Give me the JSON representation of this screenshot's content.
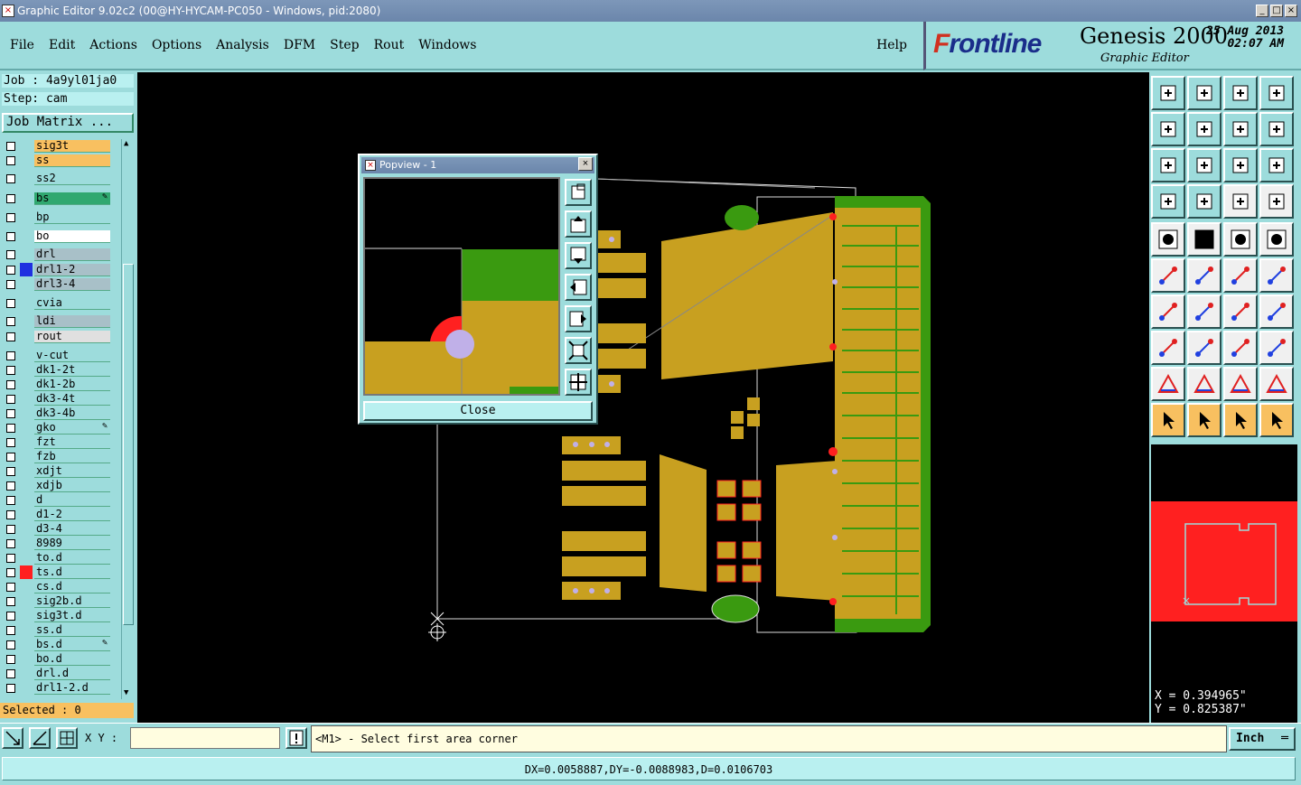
{
  "window": {
    "title": "Graphic Editor 9.02c2 (00@HY-HYCAM-PC050 - Windows, pid:2080)"
  },
  "menu": {
    "items": [
      "File",
      "Edit",
      "Actions",
      "Options",
      "Analysis",
      "DFM",
      "Step",
      "Rout",
      "Windows"
    ],
    "help": "Help"
  },
  "brand": {
    "logo_prefix": "F",
    "logo_rest": "rontline",
    "product": "Genesis 2000",
    "subtitle": "Graphic Editor",
    "date": "25 Aug 2013",
    "time": "02:07 AM"
  },
  "job": {
    "job_line": "Job : 4a9yl01ja0",
    "step_line": "Step: cam",
    "matrix_button": "Job Matrix ..."
  },
  "layers": [
    {
      "name": "sig3t",
      "color": "#f8c060",
      "swatch": ""
    },
    {
      "name": "ss",
      "color": "#f8c060",
      "swatch": ""
    },
    {
      "name": "ss2",
      "color": "#9ddcdc",
      "swatch": ""
    },
    {
      "name": "bs",
      "color": "#30a870",
      "swatch": "",
      "edit": true
    },
    {
      "name": "bp",
      "color": "#9ddcdc",
      "swatch": ""
    },
    {
      "name": "bo",
      "color": "#ffffff",
      "swatch": ""
    },
    {
      "name": "drl",
      "color": "#a8c0c8",
      "swatch": ""
    },
    {
      "name": "drl1-2",
      "color": "#a8c0c8",
      "swatch": "#2030e0"
    },
    {
      "name": "drl3-4",
      "color": "#a8c0c8",
      "swatch": ""
    },
    {
      "name": "cvia",
      "color": "#9ddcdc",
      "swatch": ""
    },
    {
      "name": "ldi",
      "color": "#a8c0c8",
      "swatch": ""
    },
    {
      "name": "rout",
      "color": "#e0e0e0",
      "swatch": ""
    },
    {
      "name": "v-cut",
      "color": "#9ddcdc",
      "swatch": ""
    },
    {
      "name": "dk1-2t",
      "color": "#9ddcdc",
      "swatch": ""
    },
    {
      "name": "dk1-2b",
      "color": "#9ddcdc",
      "swatch": ""
    },
    {
      "name": "dk3-4t",
      "color": "#9ddcdc",
      "swatch": ""
    },
    {
      "name": "dk3-4b",
      "color": "#9ddcdc",
      "swatch": ""
    },
    {
      "name": "gko",
      "color": "#9ddcdc",
      "swatch": "",
      "edit": true
    },
    {
      "name": "fzt",
      "color": "#9ddcdc",
      "swatch": ""
    },
    {
      "name": "fzb",
      "color": "#9ddcdc",
      "swatch": ""
    },
    {
      "name": "xdjt",
      "color": "#9ddcdc",
      "swatch": ""
    },
    {
      "name": "xdjb",
      "color": "#9ddcdc",
      "swatch": ""
    },
    {
      "name": "d",
      "color": "#9ddcdc",
      "swatch": ""
    },
    {
      "name": "d1-2",
      "color": "#9ddcdc",
      "swatch": ""
    },
    {
      "name": "d3-4",
      "color": "#9ddcdc",
      "swatch": ""
    },
    {
      "name": "8989",
      "color": "#9ddcdc",
      "swatch": ""
    },
    {
      "name": "to.d",
      "color": "#9ddcdc",
      "swatch": ""
    },
    {
      "name": "ts.d",
      "color": "#9ddcdc",
      "swatch": "#ff2020"
    },
    {
      "name": "cs.d",
      "color": "#9ddcdc",
      "swatch": ""
    },
    {
      "name": "sig2b.d",
      "color": "#9ddcdc",
      "swatch": ""
    },
    {
      "name": "sig3t.d",
      "color": "#9ddcdc",
      "swatch": ""
    },
    {
      "name": "ss.d",
      "color": "#9ddcdc",
      "swatch": ""
    },
    {
      "name": "bs.d",
      "color": "#9ddcdc",
      "swatch": "",
      "edit": true
    },
    {
      "name": "bo.d",
      "color": "#9ddcdc",
      "swatch": ""
    },
    {
      "name": "drl.d",
      "color": "#9ddcdc",
      "swatch": ""
    },
    {
      "name": "drl1-2.d",
      "color": "#9ddcdc",
      "swatch": ""
    }
  ],
  "selected": "Selected : 0",
  "popview": {
    "title": "Popview - 1",
    "close_label": "Close"
  },
  "coords": {
    "x": "X = 0.394965\"",
    "y": "Y = 0.825387\""
  },
  "bottom": {
    "xy_label": "X Y :",
    "xy_value": "",
    "message": "<M1> - Select first area corner",
    "unit": "Inch"
  },
  "status": "DX=0.0058887,DY=-0.0088983,D=0.0106703",
  "colors": {
    "copper": "#c8a020",
    "solder": "#3a9a10",
    "outline": "#ff0000",
    "pad": "#c0b0e8"
  }
}
